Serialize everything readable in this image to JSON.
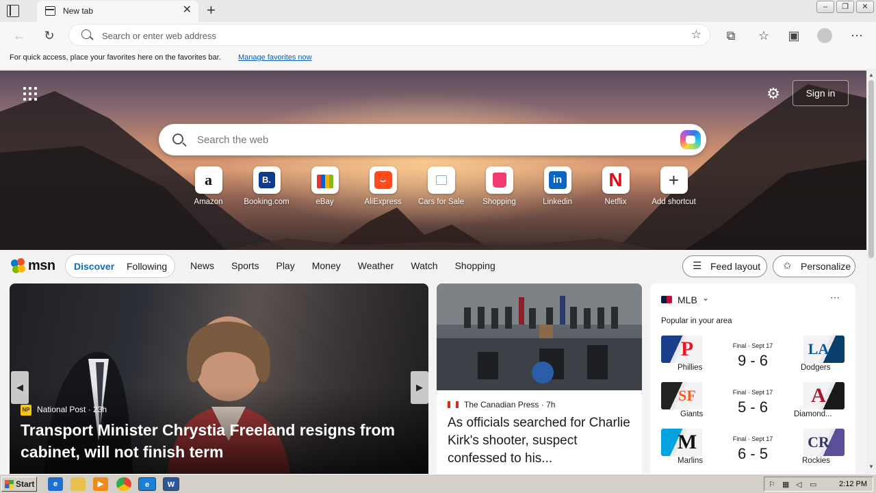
{
  "browser": {
    "tab_title": "New tab",
    "address_placeholder": "Search or enter web address",
    "favorites_bar_text": "For quick access, place your favorites here on the favorites bar.",
    "favorites_bar_link": "Manage favorites now"
  },
  "hero": {
    "signin_label": "Sign in",
    "search_placeholder": "Search the web",
    "shortcuts": [
      {
        "label": "Amazon",
        "glyph": "a"
      },
      {
        "label": "Booking.com",
        "glyph": "B."
      },
      {
        "label": "eBay",
        "glyph": ""
      },
      {
        "label": "AliExpress",
        "glyph": ""
      },
      {
        "label": "Cars for Sale",
        "glyph": ""
      },
      {
        "label": "Shopping",
        "glyph": ""
      },
      {
        "label": "Linkedin",
        "glyph": "in"
      },
      {
        "label": "Netflix",
        "glyph": "N"
      },
      {
        "label": "Add shortcut",
        "glyph": "+"
      }
    ]
  },
  "msn": {
    "logo": "msn",
    "pill": {
      "discover": "Discover",
      "following": "Following"
    },
    "nav": [
      "News",
      "Sports",
      "Play",
      "Money",
      "Weather",
      "Watch",
      "Shopping"
    ],
    "feed_layout": "Feed layout",
    "personalize": "Personalize"
  },
  "hero_card": {
    "source_badge": "NP",
    "source": "National Post · 23h",
    "headline": "Transport Minister Chrystia Freeland resigns from cabinet, will not finish term"
  },
  "mid_card": {
    "source": "The Canadian Press · 7h",
    "headline": "As officials searched for Charlie Kirk's shooter, suspect confessed to his..."
  },
  "mlb": {
    "title": "MLB",
    "subtitle": "Popular in your area",
    "games": [
      {
        "home": "Phillies",
        "home_glyph": "P",
        "away": "Dodgers",
        "away_glyph": "LA",
        "status": "Final · Sept 17",
        "score": "9 - 6",
        "home_color": "#e81828",
        "away_color": "#005a9c",
        "tile_left": "#1b3f8b",
        "tile_right": "#0b2f6b"
      },
      {
        "home": "Giants",
        "home_glyph": "SF",
        "away": "Diamond...",
        "away_glyph": "A",
        "status": "Final · Sept 17",
        "score": "5 - 6",
        "home_color": "#fd5a1e",
        "away_color": "#a71930",
        "tile_left": "#222222",
        "tile_right": "#1a1a1a"
      },
      {
        "home": "Marlins",
        "home_glyph": "M",
        "away": "Rockies",
        "away_glyph": "CR",
        "status": "Final · Sept 17",
        "score": "6 - 5",
        "home_color": "#00a3e0",
        "away_color": "#333366",
        "tile_left": "#00a3e0",
        "tile_right": "#5a4f99"
      }
    ]
  },
  "taskbar": {
    "start": "Start",
    "clock": "2:12 PM"
  },
  "colors": {
    "accent": "#0f6cbd",
    "link": "#0f5cb8"
  }
}
